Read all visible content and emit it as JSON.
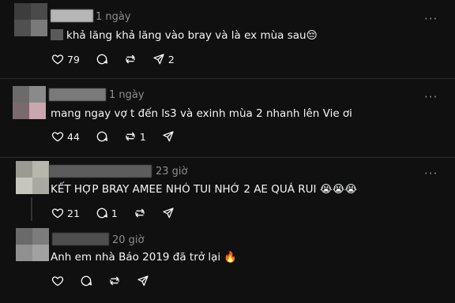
{
  "comments": [
    {
      "time": "1 ngày",
      "text": "khả lăng khả lăng vào bray và là ex mùa sau😔",
      "likes": "79",
      "replies": "",
      "reposts": "",
      "shares": "2"
    },
    {
      "time": "1 ngày",
      "text": "mang ngay vợ t đến ls3 và exinh mùa 2 nhanh lên Vie ơi",
      "likes": "44",
      "replies": "",
      "reposts": "1",
      "shares": ""
    },
    {
      "time": "23 giờ",
      "text": "KẾT HỢP BRAY AMEE NHÓ TUI NHỚ 2 AE QUÁ RUI 😭😭😭",
      "likes": "21",
      "replies": "1",
      "reposts": "",
      "shares": ""
    },
    {
      "time": "20 giờ",
      "text": "Anh em nhà Báo 2019 đã trở lại 🔥",
      "likes": "",
      "replies": "",
      "reposts": "",
      "shares": ""
    }
  ],
  "more_label": "···",
  "icons": [
    "heart-icon",
    "comment-icon",
    "repost-icon",
    "share-icon",
    "more-icon"
  ]
}
